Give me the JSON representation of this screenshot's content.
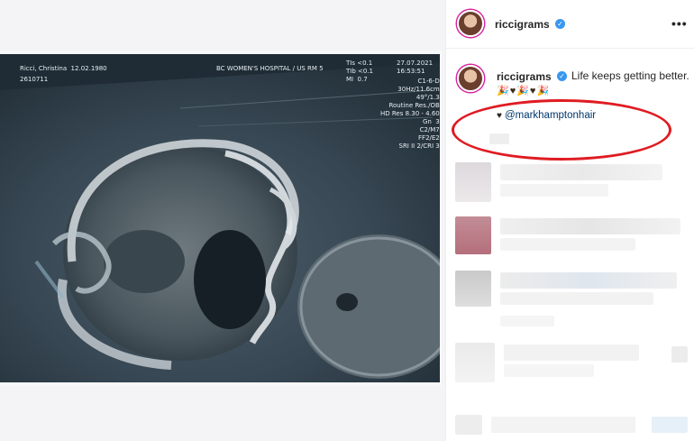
{
  "post": {
    "username": "riccigrams",
    "caption": "Life keeps getting better.",
    "emojis": "🎉♥🎉♥🎉",
    "mention": "@markhamptonhair",
    "mention_prefix": "♥",
    "more_label": "•••"
  },
  "scan": {
    "patient": "Ricci, Christina  12.02.1980",
    "patient_id": "2610711",
    "hospital": "BC WOMEN'S HOSPITAL / US RM 5",
    "index_values": "TIs <0.1\nTIb <0.1\nMI  0.7",
    "date_time": "27.07.2021\n16:53:51",
    "settings": "C1-6-D\n30Hz/11.6cm\n49°/1.3\nRoutine Res./OB\nHD Res 8.30 - 4.60\nGn  3\nC2/M7\nFF2/E2\nSRI II 2/CRI 3"
  },
  "colors": {
    "verified": "#3897f0",
    "annotation_circle": "#e01b22",
    "mention": "#00376b"
  }
}
